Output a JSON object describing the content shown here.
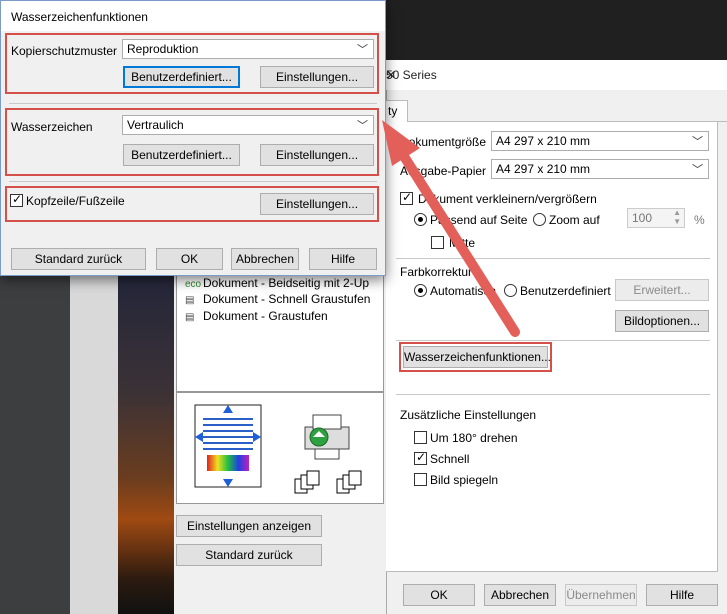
{
  "popup": {
    "title": "Wasserzeichenfunktionen",
    "copy_protection": {
      "label": "Kopierschutzmuster",
      "selected": "Reproduktion",
      "custom_button": "Benutzerdefiniert...",
      "settings_button": "Einstellungen..."
    },
    "watermark": {
      "label": "Wasserzeichen",
      "selected": "Vertraulich",
      "custom_button": "Benutzerdefiniert...",
      "settings_button": "Einstellungen..."
    },
    "header_footer": {
      "label": "Kopfzeile/Fußzeile",
      "checked": true,
      "settings_button": "Einstellungen..."
    },
    "buttons": {
      "reset": "Standard zurück",
      "ok": "OK",
      "cancel": "Abbrechen",
      "help": "Hilfe"
    }
  },
  "main": {
    "title_fragment": "50 Series",
    "tab_fragment": "ty",
    "document_size": {
      "label": "Dokumentgröße",
      "value": "A4 297 x 210 mm"
    },
    "output_paper": {
      "label": "Ausgabe-Papier",
      "value": "A4 297 x 210 mm"
    },
    "reduce_enlarge": {
      "label": "Dokument verkleinern/vergrößern",
      "checked": true
    },
    "fit_page": {
      "label": "Passend auf Seite",
      "selected": true
    },
    "zoom": {
      "label": "Zoom auf",
      "value": "100",
      "unit": "%"
    },
    "center": {
      "label": "Mitte",
      "checked": false
    },
    "color_correction": {
      "label": "Farbkorrektur",
      "auto": "Automatisch",
      "custom": "Benutzerdefiniert",
      "advanced_button": "Erweitert...",
      "image_options_button": "Bildoptionen..."
    },
    "watermark_button": "Wasserzeichenfunktionen...",
    "additional": {
      "label": "Zusätzliche Einstellungen",
      "rotate": {
        "label": "Um 180° drehen",
        "checked": false
      },
      "fast": {
        "label": "Schnell",
        "checked": true
      },
      "mirror": {
        "label": "Bild spiegeln",
        "checked": false
      }
    },
    "presets": [
      {
        "icon": "eco",
        "label": "Dokument - Beidseitig mit 2-Up"
      },
      {
        "icon": "doc",
        "label": "Dokument - Schnell Graustufen"
      },
      {
        "icon": "doc",
        "label": "Dokument - Graustufen"
      }
    ],
    "show_settings_button": "Einstellungen anzeigen",
    "reset_button": "Standard zurück",
    "footer": {
      "ok": "OK",
      "cancel": "Abbrechen",
      "apply": "Übernehmen",
      "help": "Hilfe"
    }
  },
  "colors": {
    "highlight_red": "#d6504a",
    "arrow_red": "#e3605a",
    "focus_blue": "#0078d7"
  }
}
